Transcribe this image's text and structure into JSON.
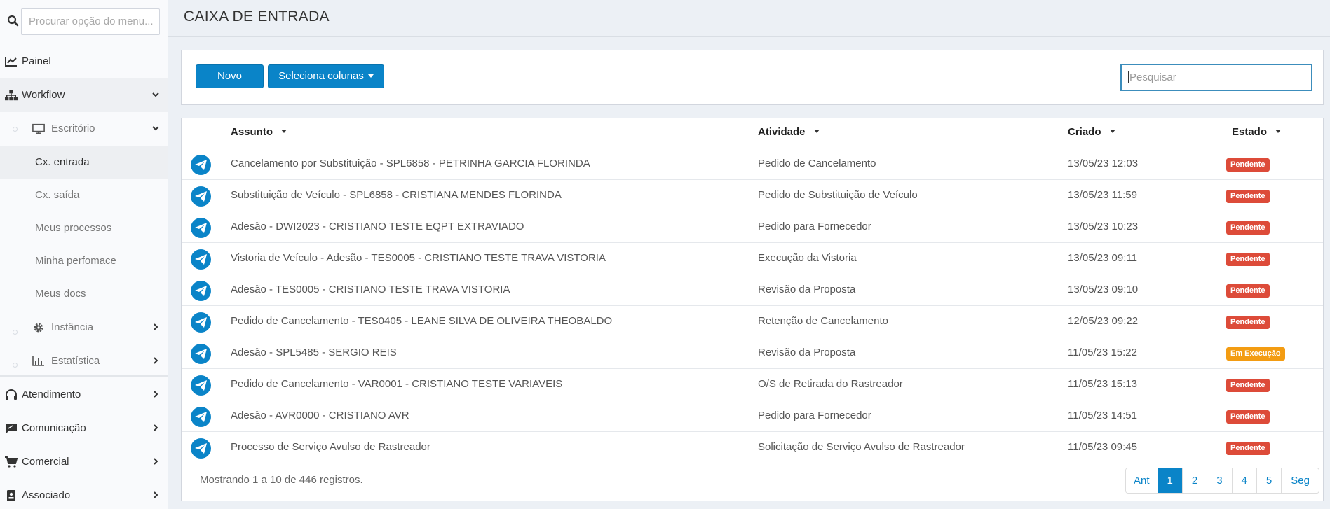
{
  "sidebar": {
    "search_placeholder": "Procurar opção do menu...",
    "items": [
      {
        "label": "Painel"
      },
      {
        "label": "Workflow"
      },
      {
        "label": "Escritório"
      },
      {
        "label": "Cx. entrada"
      },
      {
        "label": "Cx. saída"
      },
      {
        "label": "Meus processos"
      },
      {
        "label": "Minha perfomace"
      },
      {
        "label": "Meus docs"
      },
      {
        "label": "Instância"
      },
      {
        "label": "Estatística"
      },
      {
        "label": "Atendimento"
      },
      {
        "label": "Comunicação"
      },
      {
        "label": "Comercial"
      },
      {
        "label": "Associado"
      }
    ]
  },
  "page": {
    "title": "CAIXA DE ENTRADA"
  },
  "toolbar": {
    "new_label": "Novo",
    "columns_label": "Seleciona colunas",
    "search_placeholder": "Pesquisar"
  },
  "table": {
    "headers": [
      "Assunto",
      "Atividade",
      "Criado",
      "Estado"
    ],
    "rows": [
      {
        "assunto": "Cancelamento por Substituição - SPL6858 - PETRINHA GARCIA FLORINDA",
        "atividade": "Pedido de Cancelamento",
        "criado": "13/05/23 12:03",
        "estado": "Pendente"
      },
      {
        "assunto": "Substituição de Veículo - SPL6858 - CRISTIANA MENDES FLORINDA",
        "atividade": "Pedido de Substituição de Veículo",
        "criado": "13/05/23 11:59",
        "estado": "Pendente"
      },
      {
        "assunto": "Adesão - DWI2023 - CRISTIANO TESTE EQPT EXTRAVIADO",
        "atividade": "Pedido para Fornecedor",
        "criado": "13/05/23 10:23",
        "estado": "Pendente"
      },
      {
        "assunto": "Vistoria de Veículo - Adesão - TES0005 - CRISTIANO TESTE TRAVA VISTORIA",
        "atividade": "Execução da Vistoria",
        "criado": "13/05/23 09:11",
        "estado": "Pendente"
      },
      {
        "assunto": "Adesão - TES0005 - CRISTIANO TESTE TRAVA VISTORIA",
        "atividade": "Revisão da Proposta",
        "criado": "13/05/23 09:10",
        "estado": "Pendente"
      },
      {
        "assunto": "Pedido de Cancelamento - TES0405 - LEANE SILVA DE OLIVEIRA THEOBALDO",
        "atividade": "Retenção de Cancelamento",
        "criado": "12/05/23 09:22",
        "estado": "Pendente"
      },
      {
        "assunto": "Adesão - SPL5485 - SERGIO REIS",
        "atividade": "Revisão da Proposta",
        "criado": "11/05/23 15:22",
        "estado": "Em Execução"
      },
      {
        "assunto": "Pedido de Cancelamento - VAR0001 - CRISTIANO TESTE VARIAVEIS",
        "atividade": "O/S de Retirada do Rastreador",
        "criado": "11/05/23 15:13",
        "estado": "Pendente"
      },
      {
        "assunto": "Adesão - AVR0000 - CRISTIANO AVR",
        "atividade": "Pedido para Fornecedor",
        "criado": "11/05/23 14:51",
        "estado": "Pendente"
      },
      {
        "assunto": "Processo de Serviço Avulso de Rastreador",
        "atividade": "Solicitação de Serviço Avulso de Rastreador",
        "criado": "11/05/23 09:45",
        "estado": "Pendente"
      }
    ],
    "footer_info": "Mostrando 1 a 10 de 446 registros.",
    "pagination": [
      "Ant",
      "1",
      "2",
      "3",
      "4",
      "5",
      "Seg"
    ],
    "active_page": "1"
  },
  "colors": {
    "primary": "#0a84c8",
    "pending": "#dd4b39",
    "executing": "#f39c12"
  }
}
